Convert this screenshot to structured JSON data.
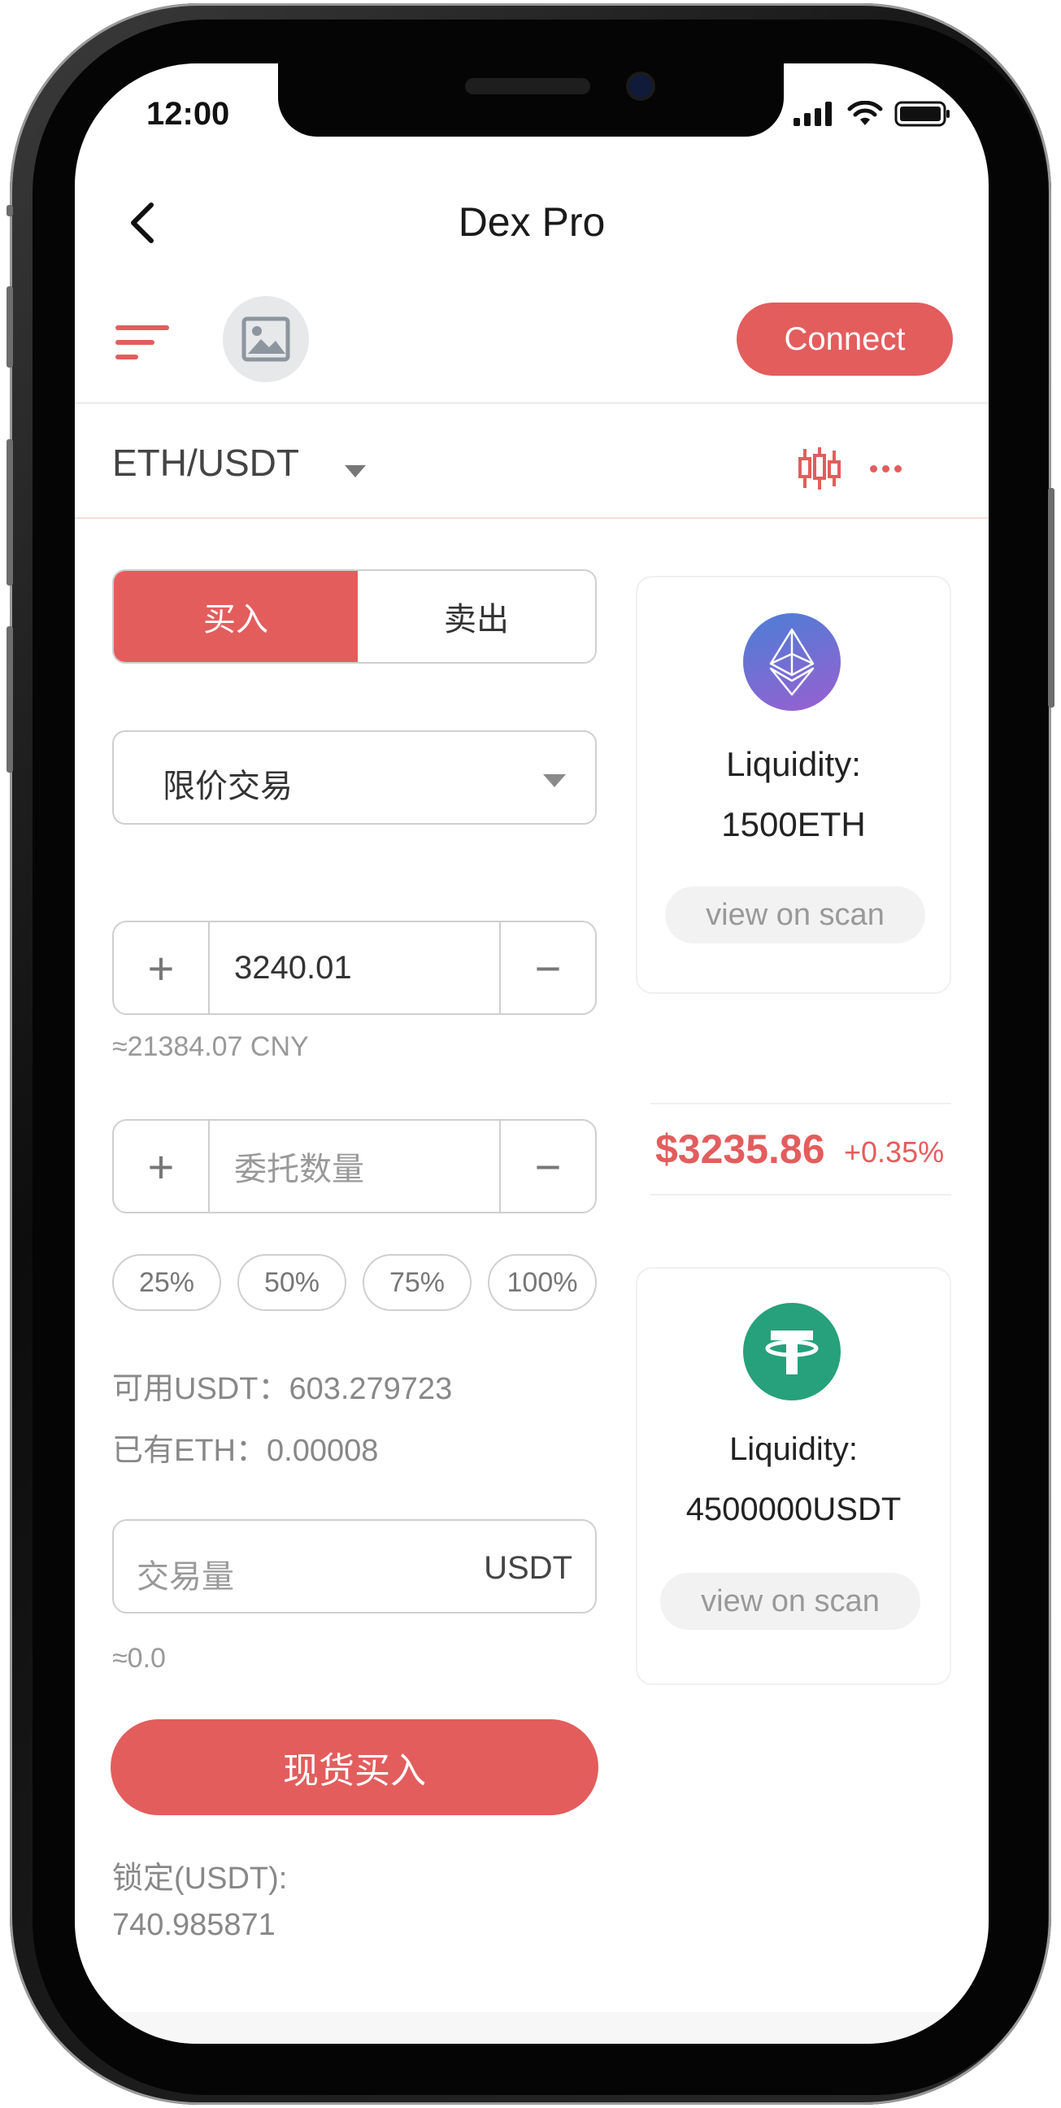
{
  "status_bar": {
    "time": "12:00"
  },
  "header": {
    "title": "Dex Pro"
  },
  "toolbar": {
    "connect_label": "Connect"
  },
  "pair": {
    "label": "ETH/USDT"
  },
  "trade": {
    "tabs": {
      "buy": "买入",
      "sell": "卖出"
    },
    "order_type": "限价交易",
    "price_value": "3240.01",
    "price_hint": "≈21384.07 CNY",
    "amount_placeholder": "委托数量",
    "percentages": [
      "25%",
      "50%",
      "75%",
      "100%"
    ],
    "available_usdt": "可用USDT：603.279723",
    "held_eth": "已有ETH：0.00008",
    "volume_placeholder": "交易量",
    "volume_unit": "USDT",
    "volume_hint": "≈0.0",
    "submit_label": "现货买入",
    "locked_label": "锁定(USDT):",
    "locked_value": "740.985871"
  },
  "pools": {
    "eth": {
      "label": "Liquidity:",
      "amount": "1500ETH",
      "scan": "view on scan"
    },
    "usdt": {
      "label": "Liquidity:",
      "amount": "4500000USDT",
      "scan": "view on scan"
    }
  },
  "ticker": {
    "price": "$3235.86",
    "change": "+0.35%"
  },
  "colors": {
    "accent": "#e35d5d",
    "eth_gradient": [
      "#4a7fd6",
      "#9a5fd0"
    ],
    "usdt": "#26a17b"
  },
  "icons": [
    "back-icon",
    "menu-icon",
    "image-icon",
    "dropdown-caret-icon",
    "candlestick-icon",
    "more-icon",
    "plus-icon",
    "minus-icon",
    "ethereum-icon",
    "tether-icon",
    "signal-icon",
    "wifi-icon",
    "battery-icon"
  ]
}
